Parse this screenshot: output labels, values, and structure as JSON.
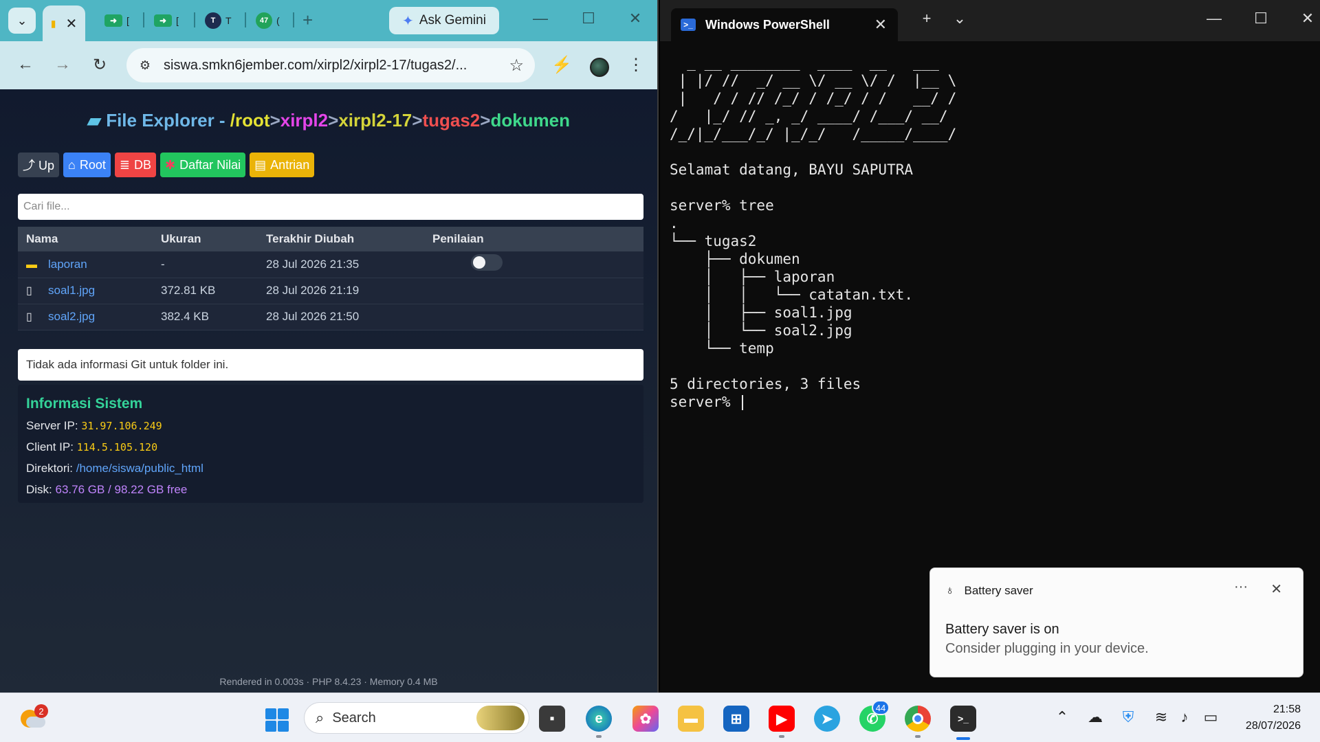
{
  "browser": {
    "tabs": {
      "mini": [
        "[",
        "[",
        "T",
        "("
      ],
      "badge_47": "47"
    },
    "ask_gemini": "Ask Gemini",
    "url": "siswa.smkn6jember.com/xirpl2/xirpl2-17/tugas2/...",
    "page": {
      "title": {
        "label": "File Explorer - ",
        "root": "/root",
        "sep": ">",
        "p1": "xirpl2",
        "p2": "xirpl2-17",
        "p3": "tugas2",
        "p4": "dokumen"
      },
      "buttons": {
        "up": "⤴ Up",
        "root": "Root",
        "db": "DB",
        "nilai": "Daftar Nilai",
        "antrian": "Antrian"
      },
      "search_placeholder": "Cari file...",
      "table": {
        "headers": [
          "Nama",
          "Ukuran",
          "Terakhir Diubah",
          "Penilaian"
        ],
        "rows": [
          {
            "name": "laporan",
            "size": "-",
            "modified": "28 Jul 2026 21:35",
            "type": "folder"
          },
          {
            "name": "soal1.jpg",
            "size": "372.81 KB",
            "modified": "28 Jul 2026 21:19",
            "type": "file"
          },
          {
            "name": "soal2.jpg",
            "size": "382.4 KB",
            "modified": "28 Jul 2026 21:50",
            "type": "file"
          }
        ],
        "toggle_on": false
      },
      "git_info": "Tidak ada informasi Git untuk folder ini.",
      "sysinfo": {
        "title": "Informasi Sistem",
        "server_ip_label": "Server IP: ",
        "server_ip": "31.97.106.249",
        "client_ip_label": "Client IP: ",
        "client_ip": "114.5.105.120",
        "dir_label": "Direktori: ",
        "dir": "/home/siswa/public_html",
        "disk_label": "Disk: ",
        "disk": "63.76 GB / 98.22 GB free"
      },
      "footer": "Rendered in 0.003s · PHP 8.4.23 · Memory 0.4 MB"
    }
  },
  "terminal": {
    "tab_title": "Windows PowerShell",
    "lines": [
      "  _ __ ________  ____  __   ___",
      " | |/ //  _/ __ \\/ __ \\/ /  |__ \\",
      " |   / / // /_/ / /_/ / /   __/ /",
      "/   |_/ // _, _/ ____/ /___/ __/",
      "/_/|_/___/_/ |_/_/   /_____/____/",
      "",
      "Selamat datang, BAYU SAPUTRA",
      "",
      "server% tree",
      ".",
      "└── tugas2",
      "    ├── dokumen",
      "    │   ├── laporan",
      "    │   │   └── catatan.txt.",
      "    │   ├── soal1.jpg",
      "    │   └── soal2.jpg",
      "    └── temp",
      "",
      "5 directories, 3 files"
    ],
    "prompt": "server% "
  },
  "toast": {
    "app": "Battery saver",
    "title": "Battery saver is on",
    "body": "Consider plugging in your device."
  },
  "taskbar": {
    "weather_badge": "2",
    "search_label": "Search",
    "whatsapp_badge": "44",
    "time": "21:58",
    "date": "28/07/2026"
  },
  "colors": {
    "tabstrip": "#4fb6c4",
    "page_bg": "#0f172a",
    "accent_green": "#34d399",
    "terminal_bg": "#0c0c0c"
  }
}
